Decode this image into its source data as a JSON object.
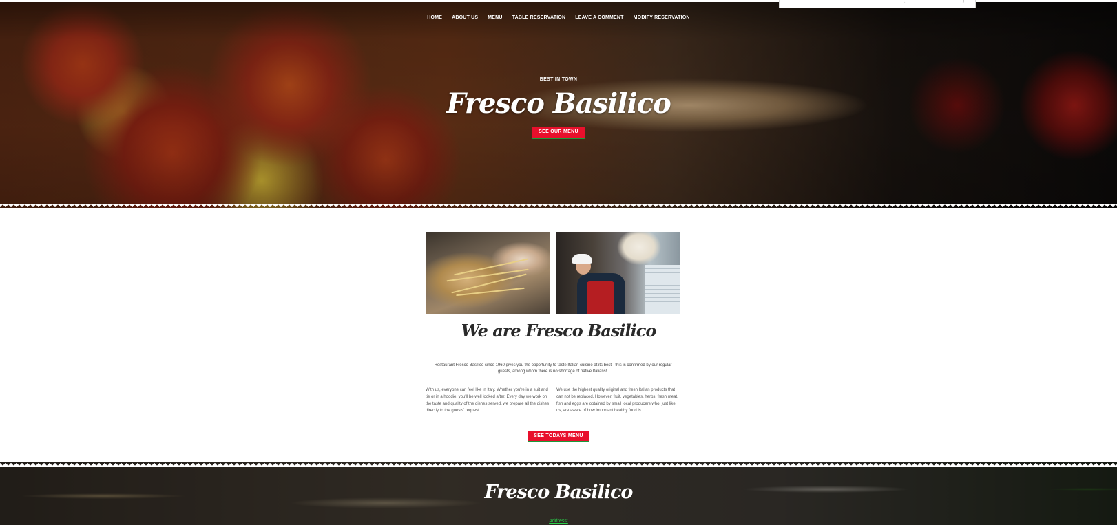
{
  "nav": {
    "items": [
      "HOME",
      "ABOUT US",
      "MENU",
      "TABLE RESERVATION",
      "LEAVE A COMMENT",
      "MODIFY RESERVATION"
    ]
  },
  "hero": {
    "kicker": "BEST IN TOWN",
    "title": "Fresco Basilico",
    "button_label": "SEE OUR MENU"
  },
  "about": {
    "title": "We are Fresco Basilico",
    "lead": "Restaurant Fresco Basilico since 1960 gives you the opportunity to taste Italian cuisine at its best - this is confirmed by our regular guests, among whom there is no shortage of native Italians!.",
    "col_left": "With us, everyone can feel like in Italy. Whether you're in a suit and tie or in a hoodie, you'll be well looked after. Every day we work on the taste and quality of the dishes served. we prepare all the dishes directly to the guests' request.",
    "col_right": "We use the highest quality original and fresh Italian products that can not be replaced. However, fruit, vegetables, herbs, fresh meat, fish and eggs are obtained by small local producers who, just like us, are aware of how important healthy food is.",
    "button_label": "SEE TODAYS MENU"
  },
  "footer": {
    "title": "Fresco Basilico",
    "address_label": "Address:"
  },
  "colors": {
    "accent_red": "#e8102c",
    "accent_green": "#1a9a3a",
    "link_green": "#2ad04a"
  }
}
